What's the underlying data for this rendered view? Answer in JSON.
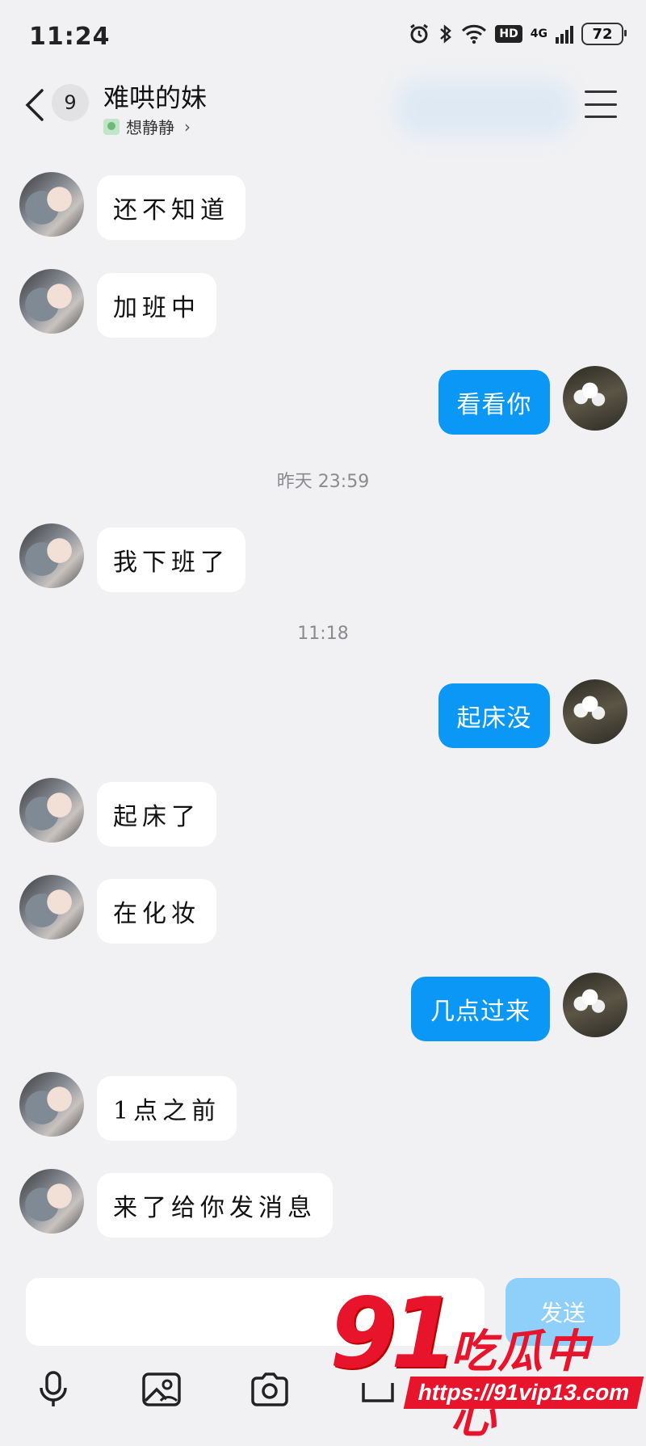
{
  "status_bar": {
    "time": "11:24",
    "network": "4G",
    "hd": "HD",
    "battery": "72"
  },
  "header": {
    "unread_count": "9",
    "title": "难哄的妹",
    "subtitle": "想静静"
  },
  "messages": [
    {
      "side": "in",
      "text": "还不知道"
    },
    {
      "side": "in",
      "text": "加班中"
    },
    {
      "side": "out",
      "text": "看看你"
    },
    {
      "type": "time",
      "text": "昨天 23:59"
    },
    {
      "side": "in",
      "text": "我下班了"
    },
    {
      "type": "time",
      "text": "11:18"
    },
    {
      "side": "out",
      "text": "起床没"
    },
    {
      "side": "in",
      "text": "起床了"
    },
    {
      "side": "in",
      "text": "在化妆"
    },
    {
      "side": "out",
      "text": "几点过来"
    },
    {
      "side": "in",
      "text": "1点之前"
    },
    {
      "side": "in",
      "text": "来了给你发消息"
    }
  ],
  "composer": {
    "send_label": "发送"
  },
  "watermark": {
    "number": "91",
    "brand": "吃瓜中心",
    "url": "https://91vip13.com"
  },
  "colors": {
    "accent": "#0a97f5",
    "background": "#f1f1f3",
    "watermark": "#e8142c"
  }
}
